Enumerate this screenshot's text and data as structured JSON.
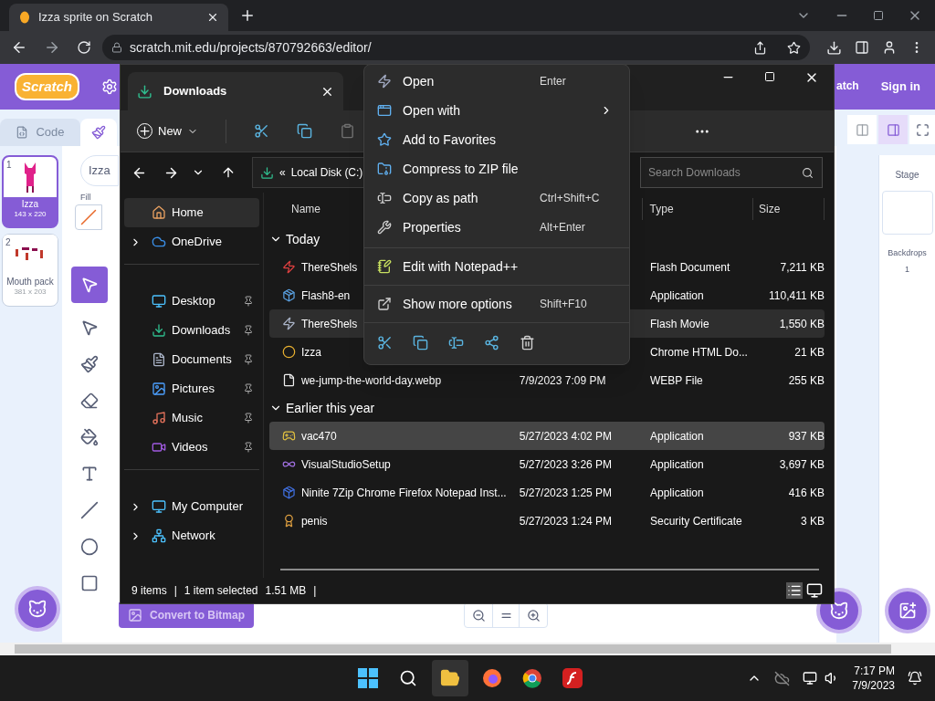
{
  "browser": {
    "tab_title": "Izza sprite on Scratch",
    "url": "scratch.mit.edu/projects/870792663/editor/"
  },
  "scratch": {
    "logo": "Scratch",
    "menu_items": [
      "atch",
      "Sign in"
    ],
    "tabs": [
      {
        "label": "Code",
        "selected": false
      }
    ],
    "costumes": [
      {
        "number": "1",
        "name": "Izza",
        "size": "143 x 220",
        "selected": true
      },
      {
        "number": "2",
        "name": "Mouth pack",
        "size": "381 x 203",
        "selected": false
      }
    ],
    "costume_name": "Izza",
    "fill_label": "Fill",
    "convert_button": "Convert to Bitmap",
    "stage": {
      "title": "Stage",
      "backdrops_label": "Backdrops",
      "backdrops_count": "1"
    }
  },
  "explorer": {
    "title": "Downloads",
    "new_button": "New",
    "path_prefix": "«",
    "path": "Local Disk (C:)",
    "search_placeholder": "Search Downloads",
    "sidebar": [
      {
        "items": [
          {
            "label": "Home",
            "kind": "home",
            "selected": true,
            "expandable": false,
            "pinned": false
          },
          {
            "label": "OneDrive",
            "kind": "cloud",
            "selected": false,
            "expandable": true,
            "pinned": false
          }
        ]
      },
      {
        "items": [
          {
            "label": "Desktop",
            "kind": "desktop",
            "selected": false,
            "expandable": false,
            "pinned": true
          },
          {
            "label": "Downloads",
            "kind": "downloads",
            "selected": false,
            "expandable": false,
            "pinned": true
          },
          {
            "label": "Documents",
            "kind": "documents",
            "selected": false,
            "expandable": false,
            "pinned": true
          },
          {
            "label": "Pictures",
            "kind": "pictures",
            "selected": false,
            "expandable": false,
            "pinned": true
          },
          {
            "label": "Music",
            "kind": "music",
            "selected": false,
            "expandable": false,
            "pinned": true
          },
          {
            "label": "Videos",
            "kind": "videos",
            "selected": false,
            "expandable": false,
            "pinned": true
          }
        ]
      },
      {
        "items": [
          {
            "label": "My Computer",
            "kind": "computer",
            "selected": false,
            "expandable": true,
            "pinned": false
          },
          {
            "label": "Network",
            "kind": "network",
            "selected": false,
            "expandable": true,
            "pinned": false
          }
        ]
      }
    ],
    "columns": [
      "Name",
      "Type",
      "Size"
    ],
    "groups": [
      {
        "title": "Today",
        "expanded": true,
        "rows": [
          {
            "name": "ThereShels",
            "type": "Flash Document",
            "size": "7,211 KB",
            "kind": "flash",
            "selected": false,
            "hovered": false
          },
          {
            "name": "Flash8-en",
            "type": "Application",
            "size": "110,411 KB",
            "kind": "installer",
            "selected": false,
            "hovered": false
          },
          {
            "name": "ThereShels",
            "type": "Flash Movie",
            "size": "1,550 KB",
            "kind": "movie",
            "selected": true,
            "hovered": false
          },
          {
            "name": "Izza",
            "type": "Chrome HTML Do...",
            "size": "21 KB",
            "kind": "chrome",
            "selected": false,
            "hovered": false
          },
          {
            "name": "we-jump-the-world-day.webp",
            "date": "7/9/2023 7:09 PM",
            "type": "WEBP File",
            "size": "255 KB",
            "kind": "document",
            "selected": false,
            "hovered": false
          }
        ]
      },
      {
        "title": "Earlier this year",
        "expanded": true,
        "rows": [
          {
            "name": "vac470",
            "date": "5/27/2023 4:02 PM",
            "type": "Application",
            "size": "937 KB",
            "kind": "emulator",
            "selected": false,
            "hovered": true
          },
          {
            "name": "VisualStudioSetup",
            "date": "5/27/2023 3:26 PM",
            "type": "Application",
            "size": "3,697 KB",
            "kind": "studio",
            "selected": false,
            "hovered": false
          },
          {
            "name": "Ninite 7Zip Chrome Firefox Notepad Inst...",
            "date": "5/27/2023 1:25 PM",
            "type": "Application",
            "size": "416 KB",
            "kind": "ninite",
            "selected": false,
            "hovered": false
          },
          {
            "name": "penis",
            "date": "5/27/2023 1:24 PM",
            "type": "Security Certificate",
            "size": "3 KB",
            "kind": "certificate",
            "selected": false,
            "hovered": false
          }
        ]
      }
    ],
    "status": [
      "9 items",
      "|",
      "1 item selected",
      "1.51 MB",
      "|"
    ]
  },
  "context_menu": {
    "groups": [
      {
        "items": [
          {
            "label": "Open",
            "shortcut": "Enter",
            "kind": "open",
            "submenu": false
          },
          {
            "label": "Open with",
            "kind": "openwith",
            "submenu": true
          },
          {
            "label": "Add to Favorites",
            "kind": "favorite",
            "submenu": false
          },
          {
            "label": "Compress to ZIP file",
            "kind": "zip",
            "submenu": false
          },
          {
            "label": "Copy as path",
            "shortcut": "Ctrl+Shift+C",
            "kind": "path",
            "submenu": false
          },
          {
            "label": "Properties",
            "shortcut": "Alt+Enter",
            "kind": "properties",
            "submenu": false
          }
        ]
      },
      {
        "items": [
          {
            "label": "Edit with Notepad++",
            "kind": "notepad",
            "submenu": false
          }
        ]
      },
      {
        "items": [
          {
            "label": "Show more options",
            "shortcut": "Shift+F10",
            "kind": "more",
            "submenu": false
          }
        ]
      }
    ]
  },
  "taskbar": {
    "time": "7:17 PM",
    "date": "7/9/2023"
  }
}
